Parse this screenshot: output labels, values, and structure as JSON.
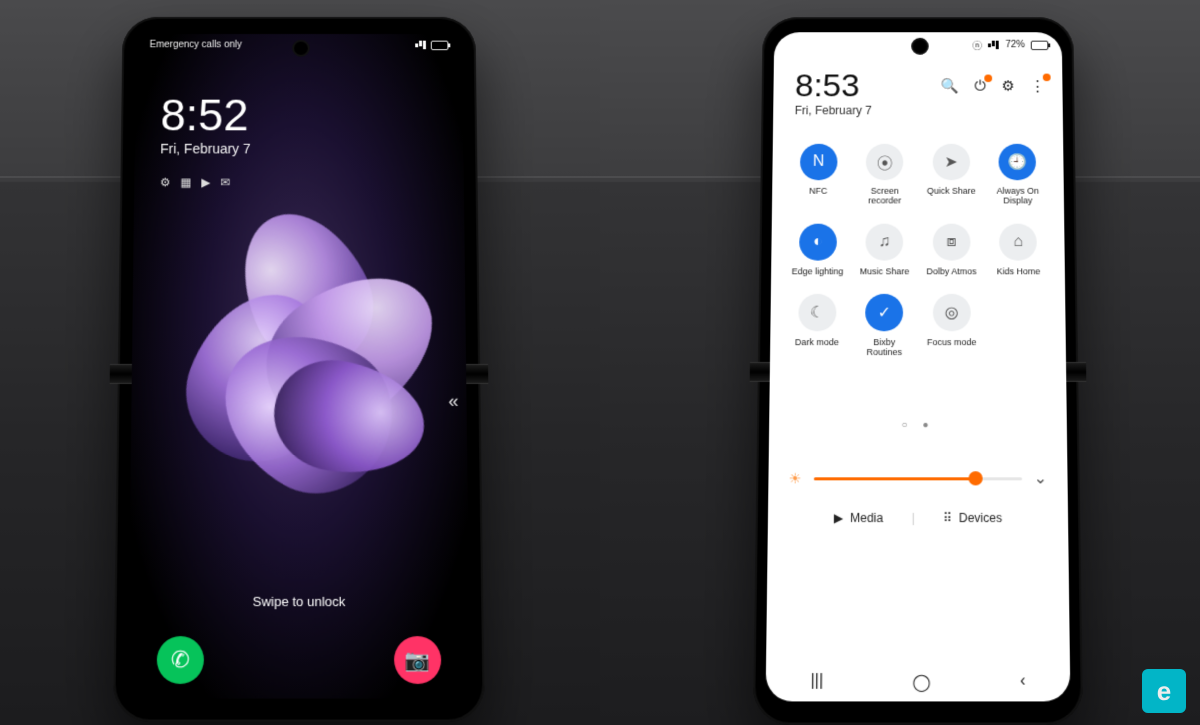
{
  "left_phone": {
    "status_left": "Emergency calls only",
    "time": "8:52",
    "date": "Fri, February 7",
    "swipe_hint": "Swipe to unlock",
    "notif_icons": [
      "gear-icon",
      "gallery-icon",
      "play-icon",
      "chat-icon"
    ]
  },
  "right_phone": {
    "battery_text": "72%",
    "time": "8:53",
    "date": "Fri, February 7",
    "quick_settings": [
      {
        "label": "NFC",
        "icon": "nfc-icon",
        "on": true
      },
      {
        "label": "Screen recorder",
        "icon": "screen-recorder-icon",
        "on": false
      },
      {
        "label": "Quick Share",
        "icon": "quick-share-icon",
        "on": false
      },
      {
        "label": "Always On Display",
        "icon": "aod-icon",
        "on": true
      },
      {
        "label": "Edge lighting",
        "icon": "edge-lighting-icon",
        "on": true
      },
      {
        "label": "Music Share",
        "icon": "music-share-icon",
        "on": false
      },
      {
        "label": "Dolby Atmos",
        "icon": "dolby-icon",
        "on": false
      },
      {
        "label": "Kids Home",
        "icon": "kids-home-icon",
        "on": false
      },
      {
        "label": "Dark mode",
        "icon": "dark-mode-icon",
        "on": false
      },
      {
        "label": "Bixby Routines",
        "icon": "bixby-icon",
        "on": true
      },
      {
        "label": "Focus mode",
        "icon": "focus-icon",
        "on": false
      }
    ],
    "media_label": "Media",
    "devices_label": "Devices",
    "brightness_percent": 78
  },
  "icon_glyph": {
    "nfc-icon": "N",
    "screen-recorder-icon": "⦿",
    "quick-share-icon": "➤",
    "aod-icon": "🕘",
    "edge-lighting-icon": "◐",
    "music-share-icon": "♫",
    "dolby-icon": "⧈",
    "kids-home-icon": "⌂",
    "dark-mode-icon": "☾",
    "bixby-icon": "✓",
    "focus-icon": "◎",
    "gear-icon": "⚙",
    "gallery-icon": "▦",
    "play-icon": "▶",
    "chat-icon": "✉",
    "search-icon": "🔍",
    "power-icon": "⏻",
    "settings-icon": "⚙",
    "more-icon": "⋮",
    "phone-icon": "✆",
    "camera-icon": "📷",
    "sun-icon": "☀",
    "chevron-down-icon": "⌄",
    "media-icon": "▶",
    "devices-icon": "⠿",
    "recents-icon": "|||",
    "home-icon": "◯",
    "back-icon": "‹",
    "double-chevron-icon": "«"
  },
  "watermark": "e"
}
